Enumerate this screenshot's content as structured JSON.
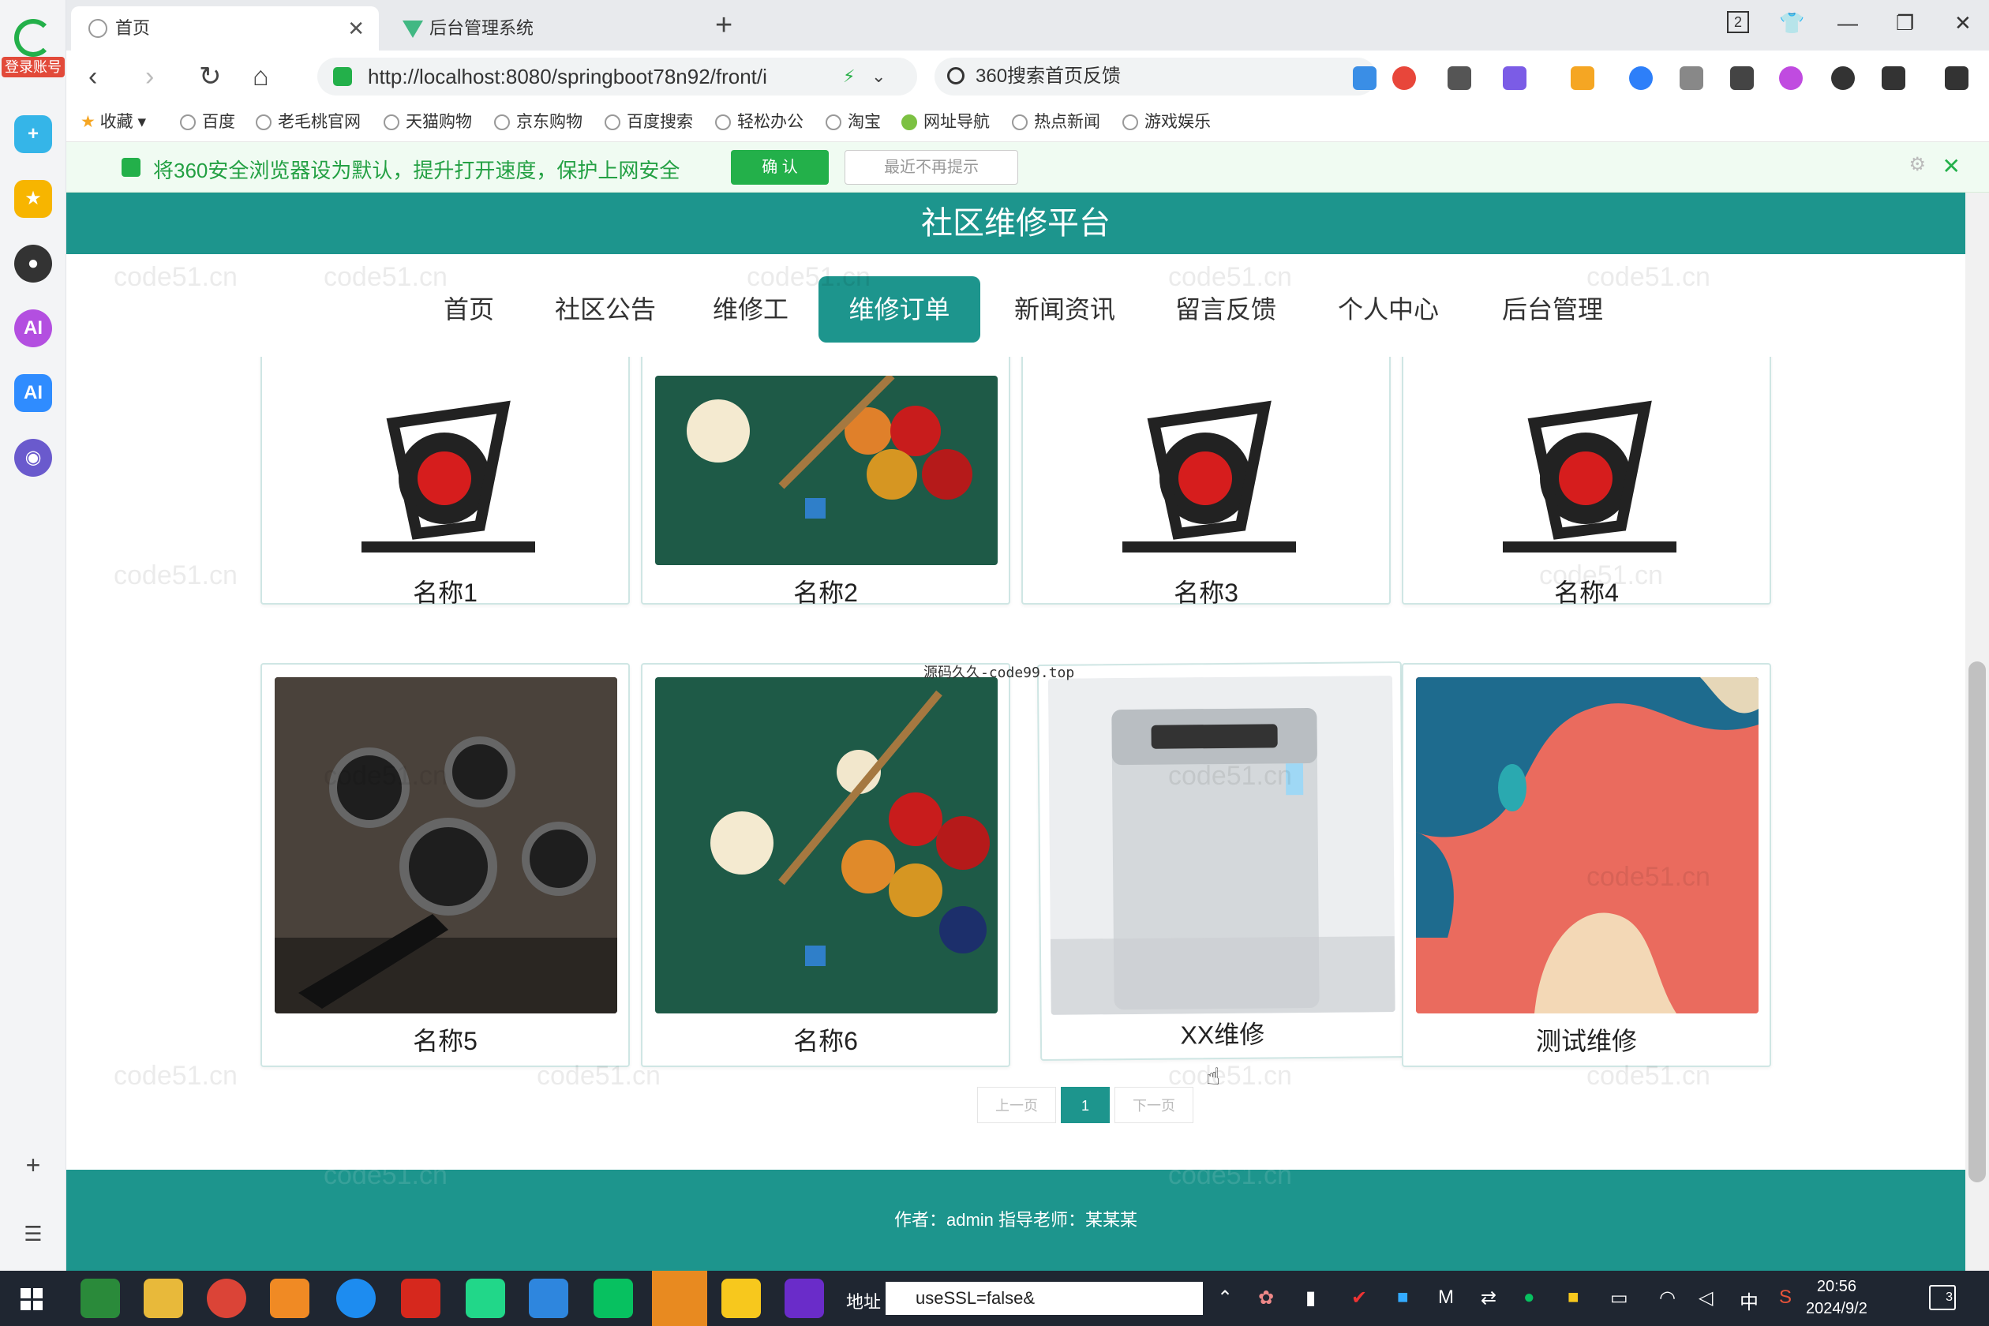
{
  "browser": {
    "login_badge": "登录账号",
    "tabs": [
      {
        "label": "首页",
        "active": true
      },
      {
        "label": "后台管理系统",
        "active": false
      }
    ],
    "new_tab": "+",
    "tab_counter": "2",
    "url": "http://localhost:8080/springboot78n92/front/i",
    "search_text": "360搜索首页反馈",
    "bookmarks": [
      "收藏",
      "百度",
      "老毛桃官网",
      "天猫购物",
      "京东购物",
      "百度搜索",
      "轻松办公",
      "淘宝",
      "网址导航",
      "热点新闻",
      "游戏娱乐"
    ],
    "infobar": {
      "message": "将360安全浏览器设为默认，提升打开速度，保护上网安全",
      "confirm": "确 认",
      "later": "最近不再提示"
    }
  },
  "site": {
    "title": "社区维修平台",
    "nav": [
      {
        "label": "首页",
        "active": false
      },
      {
        "label": "社区公告",
        "active": false
      },
      {
        "label": "维修工",
        "active": false
      },
      {
        "label": "维修订单",
        "active": true
      },
      {
        "label": "新闻资讯",
        "active": false
      },
      {
        "label": "留言反馈",
        "active": false
      },
      {
        "label": "个人中心",
        "active": false
      },
      {
        "label": "后台管理",
        "active": false
      }
    ],
    "items": [
      {
        "name": "名称1",
        "image": "exercise-bike"
      },
      {
        "name": "名称2",
        "image": "billiard-balls"
      },
      {
        "name": "名称3",
        "image": "exercise-bike"
      },
      {
        "name": "名称4",
        "image": "exercise-bike"
      },
      {
        "name": "名称5",
        "image": "gym-wall"
      },
      {
        "name": "名称6",
        "image": "billiard-balls"
      },
      {
        "name": "XX维修",
        "image": "washing-machine"
      },
      {
        "name": "测试维修",
        "image": "abstract-shapes"
      }
    ],
    "overlay_text": "源码久久-code99.top",
    "pagination": {
      "prev": "上一页",
      "current": "1",
      "next": "下一页"
    },
    "footer": "作者：admin 指导老师：某某某",
    "watermark": "code51.cn"
  },
  "taskbar": {
    "addr_label": "地址",
    "addr_value": "useSSL=false&",
    "ime": "中",
    "time": "20:56",
    "date": "2024/9/2",
    "notifications": "3"
  }
}
